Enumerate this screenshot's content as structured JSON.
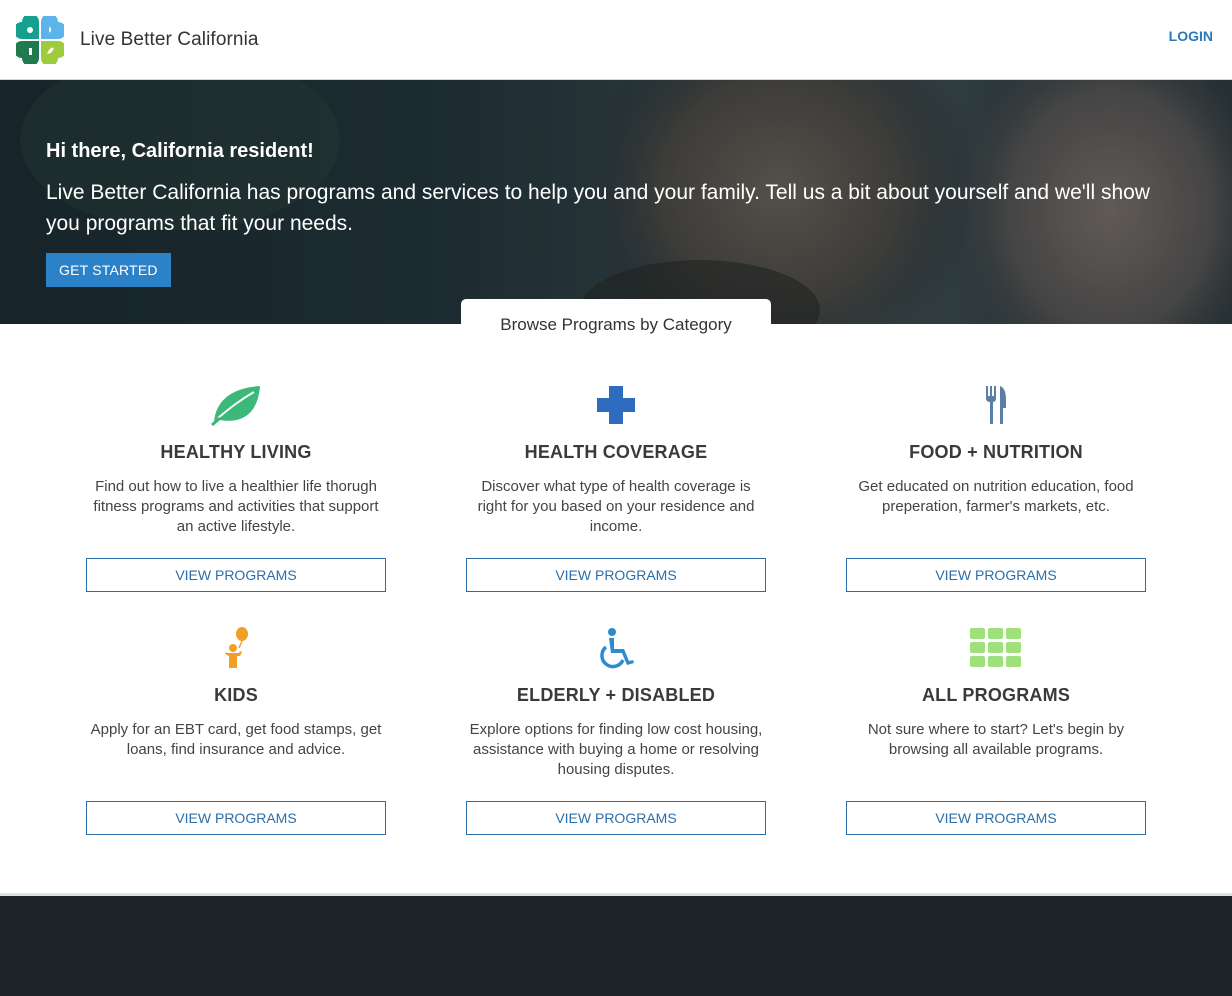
{
  "header": {
    "brand": "Live Better California",
    "login_label": "LOGIN"
  },
  "hero": {
    "title": "Hi there, California resident!",
    "text": "Live Better California has programs and services to help you and your family. Tell us a bit about yourself and we'll show you programs that fit your needs.",
    "cta_label": "GET STARTED"
  },
  "browse": {
    "tab_label": "Browse Programs by Category"
  },
  "categories": [
    {
      "icon": "leaf-icon",
      "icon_color": "#3cb878",
      "title": "HEALTHY LIVING",
      "desc": "Find out how to live a healthier life thorugh fitness programs and activities that support an active lifestyle.",
      "button": "VIEW PROGRAMS"
    },
    {
      "icon": "medical-cross-icon",
      "icon_color": "#2f6cc0",
      "title": "HEALTH COVERAGE",
      "desc": "Discover what type of health coverage is right for you based on your residence and income.",
      "button": "VIEW PROGRAMS"
    },
    {
      "icon": "fork-knife-icon",
      "icon_color": "#5a7fa6",
      "title": "FOOD + NUTRITION",
      "desc": "Get educated on nutrition education, food preperation, farmer's markets, etc.",
      "button": "VIEW PROGRAMS"
    },
    {
      "icon": "child-balloon-icon",
      "icon_color": "#f0a125",
      "title": "KIDS",
      "desc": "Apply for an EBT card, get food stamps, get loans, find insurance and advice.",
      "button": "VIEW PROGRAMS"
    },
    {
      "icon": "wheelchair-icon",
      "icon_color": "#2f8bd0",
      "title": "ELDERLY + DISABLED",
      "desc": "Explore options for finding low cost housing, assistance with buying a home or resolving housing disputes.",
      "button": "VIEW PROGRAMS"
    },
    {
      "icon": "grid-icon",
      "icon_color": "#9fe07a",
      "title": "ALL PROGRAMS",
      "desc": "Not sure where to start? Let's begin by browsing all available programs.",
      "button": "VIEW PROGRAMS"
    }
  ],
  "colors": {
    "accent": "#2b82c9",
    "link": "#2b78bc",
    "footer": "#1b2329"
  }
}
